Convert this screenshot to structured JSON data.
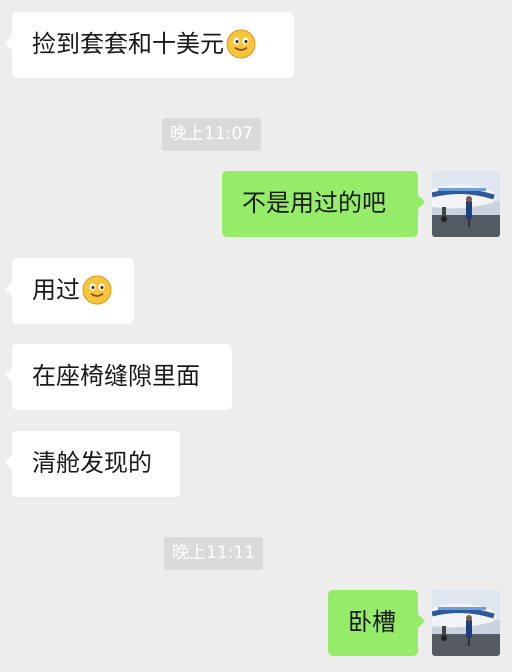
{
  "messages": [
    {
      "side": "left",
      "text": "捡到套套和十美元",
      "emoji": "smile-emoji"
    },
    {
      "type": "timestamp",
      "text": "晚上11:07"
    },
    {
      "side": "right",
      "text": "不是用过的吧",
      "avatar": "airplane-avatar"
    },
    {
      "side": "left",
      "text": "用过",
      "emoji": "smile-emoji"
    },
    {
      "side": "left",
      "text": "在座椅缝隙里面"
    },
    {
      "side": "left",
      "text": "清舱发现的"
    },
    {
      "type": "timestamp",
      "text": "晚上11:11"
    },
    {
      "side": "right",
      "text": "卧槽",
      "avatar": "airplane-avatar"
    }
  ],
  "colors": {
    "background": "#ededed",
    "left_bubble": "#ffffff",
    "right_bubble": "#95ec69",
    "timestamp_bg": "#dadada",
    "timestamp_text": "#ffffff"
  }
}
